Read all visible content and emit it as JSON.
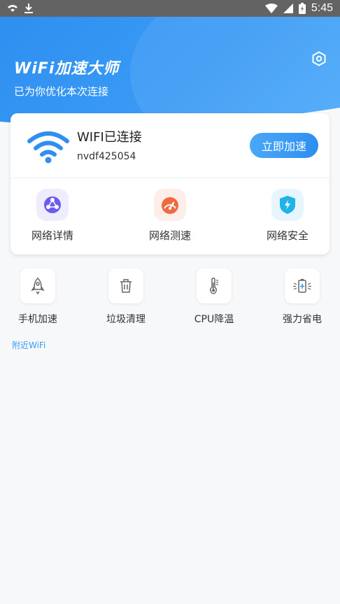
{
  "status_bar": {
    "time": "5:45",
    "icons": [
      "wifi-question-icon",
      "download-icon",
      "wifi-signal-icon",
      "cell-signal-icon",
      "battery-icon"
    ]
  },
  "header": {
    "title": "WiFi加速大师",
    "subtitle": "已为你优化本次连接",
    "settings_icon": "settings-hexagon-icon"
  },
  "connection": {
    "status": "WIFI已连接",
    "ssid": "nvdf425054",
    "boost_label": "立即加速"
  },
  "card_actions": [
    {
      "label": "网络详情",
      "icon": "network-details-icon",
      "color": "#6b5cf0",
      "bg": "#efedfd"
    },
    {
      "label": "网络测速",
      "icon": "speedometer-icon",
      "color": "#f06a3f",
      "bg": "#fdeee9"
    },
    {
      "label": "网络安全",
      "icon": "shield-icon",
      "color": "#1fb3e8",
      "bg": "#e6f6fc"
    }
  ],
  "tools": [
    {
      "label": "手机加速",
      "icon": "rocket-icon"
    },
    {
      "label": "垃圾清理",
      "icon": "trash-icon"
    },
    {
      "label": "CPU降温",
      "icon": "thermometer-icon"
    },
    {
      "label": "强力省电",
      "icon": "battery-saver-icon"
    }
  ],
  "nearby": {
    "label": "附近WiFi"
  },
  "colors": {
    "accent": "#3a9af5",
    "header": "#2f8ff0"
  }
}
